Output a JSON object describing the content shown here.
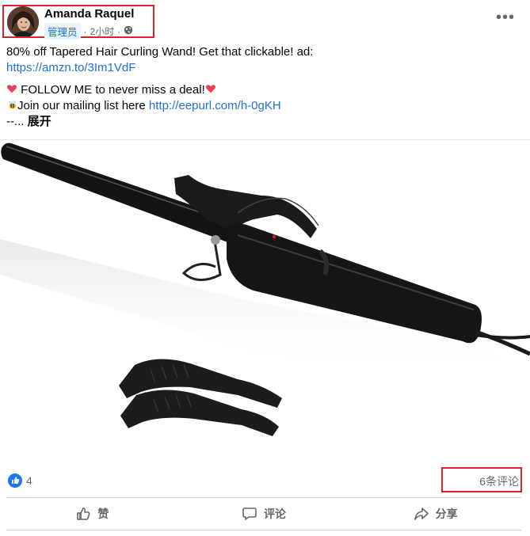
{
  "post": {
    "author": "Amanda Raquel",
    "role": "管理员",
    "time": "2小时",
    "separator": "·",
    "audience_icon": "globe-icon",
    "menu_icon": "more-horizontal-icon",
    "menu_label": "•••",
    "lines": {
      "l1": "80% off Tapered Hair Curling Wand! Get that clickable! ad:",
      "l2_link": "https://amzn.to/3Im1VdF",
      "l3_text": " FOLLOW ME to never miss a deal!",
      "l4_text": "Join our mailing list here ",
      "l4_link": "http://eepurl.com/h-0gKH",
      "l5_prefix": "--...",
      "l5_more": "展开"
    }
  },
  "reactions": {
    "like_count": "4",
    "like_icon": "thumbs-up-icon",
    "comments": "6条评论"
  },
  "actions": {
    "like": "赞",
    "comment": "评论",
    "share": "分享"
  },
  "colors": {
    "link": "#216fdb",
    "accent": "#1877f2",
    "highlight": "#e02020",
    "muted": "#65676b"
  }
}
